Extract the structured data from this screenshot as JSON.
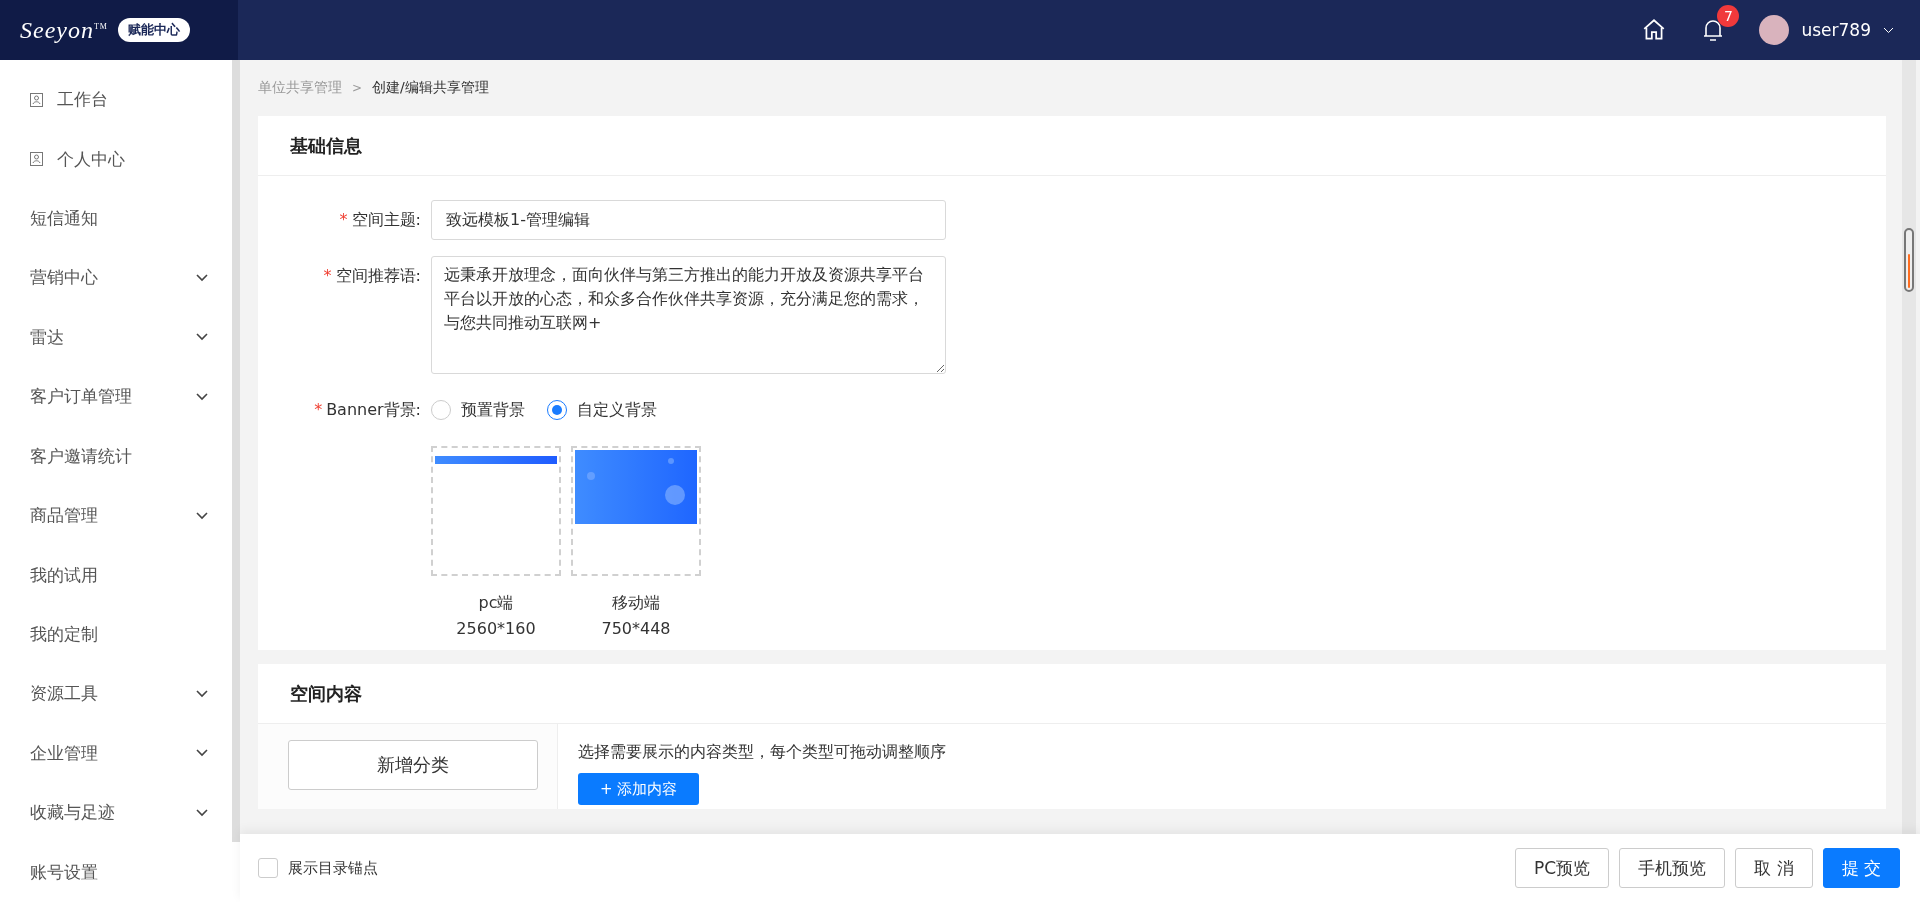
{
  "header": {
    "logo": "Seeyon",
    "logo_tm": "TM",
    "product_badge": "赋能中心",
    "notifications": "7",
    "user": "user789"
  },
  "sidebar": {
    "items": [
      {
        "label": "工作台",
        "kind": "icon"
      },
      {
        "label": "个人中心",
        "kind": "icon"
      },
      {
        "label": "短信通知",
        "kind": "link"
      },
      {
        "label": "营销中心",
        "kind": "group"
      },
      {
        "label": "雷达",
        "kind": "group"
      },
      {
        "label": "客户订单管理",
        "kind": "group"
      },
      {
        "label": "客户邀请统计",
        "kind": "link"
      },
      {
        "label": "商品管理",
        "kind": "group"
      },
      {
        "label": "我的试用",
        "kind": "link"
      },
      {
        "label": "我的定制",
        "kind": "link"
      },
      {
        "label": "资源工具",
        "kind": "group"
      },
      {
        "label": "企业管理",
        "kind": "group"
      },
      {
        "label": "收藏与足迹",
        "kind": "group"
      },
      {
        "label": "账号设置",
        "kind": "link"
      }
    ]
  },
  "breadcrumb": [
    {
      "label": "单位共享管理",
      "current": false
    },
    {
      "label": "创建/编辑共享管理",
      "current": true
    }
  ],
  "breadcrumb_separator": ">",
  "basic_info": {
    "title": "基础信息",
    "fields": [
      {
        "label": "空间主题:",
        "required_mark": "*",
        "kind": "input",
        "value": "致远模板1-管理编辑"
      },
      {
        "label": "空间推荐语:",
        "required_mark": "*",
        "kind": "textarea",
        "value": "远秉承开放理念，面向伙伴与第三方推出的能力开放及资源共享平台平台以开放的心态，和众多合作伙伴共享资源，充分满足您的需求，与您共同推动互联网+"
      }
    ],
    "banner": {
      "label": "Banner背景:",
      "required_mark": "*",
      "options": [
        {
          "label": "预置背景",
          "selected": false
        },
        {
          "label": "自定义背景",
          "selected": true
        }
      ],
      "previews": [
        {
          "kind": "pc",
          "name": "pc端",
          "size": "2560*160"
        },
        {
          "kind": "mobile",
          "name": "移动端",
          "size": "750*448"
        }
      ]
    }
  },
  "space_content": {
    "title": "空间内容",
    "add_category": "新增分类",
    "hint": "选择需要展示的内容类型，每个类型可拖动调整顺序",
    "add_content": "+ 添加内容"
  },
  "footer": {
    "anchor_label": "展示目录锚点",
    "anchor_checked": false,
    "buttons": [
      {
        "label": "PC预览",
        "primary": false
      },
      {
        "label": "手机预览",
        "primary": false
      },
      {
        "label": "取 消",
        "primary": false
      },
      {
        "label": "提 交",
        "primary": true
      }
    ]
  }
}
